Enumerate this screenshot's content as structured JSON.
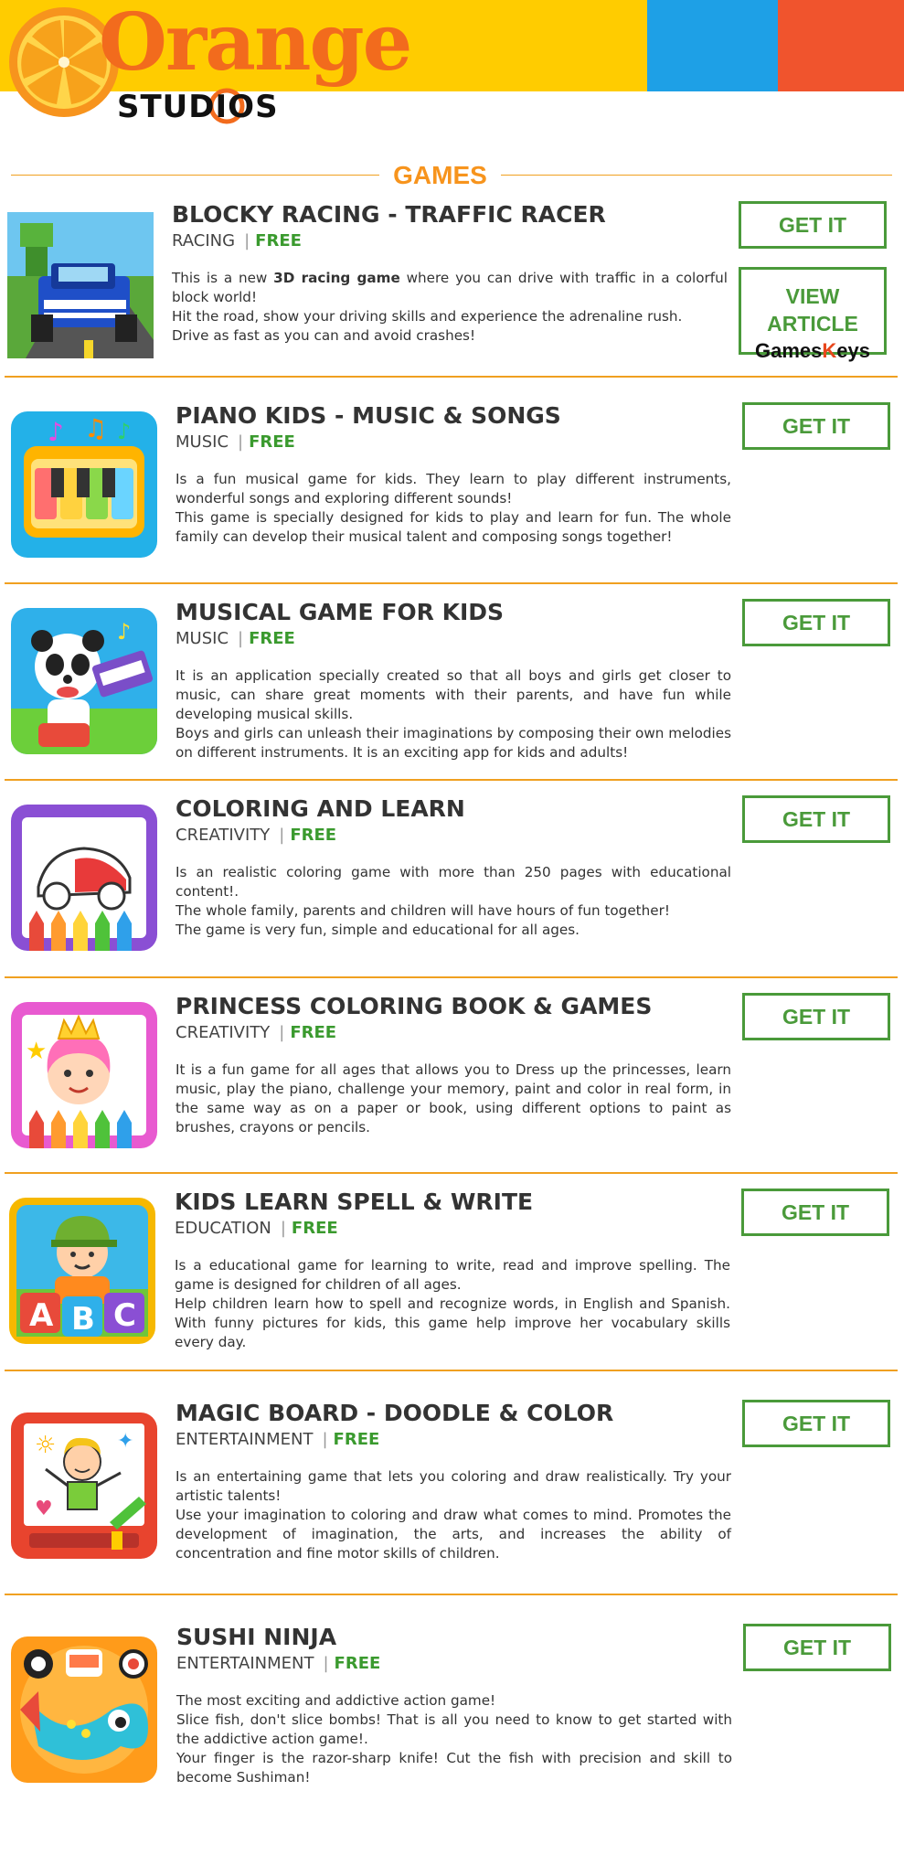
{
  "brand": {
    "logo_word": "Orange",
    "logo_sub": "STUDIOS",
    "colors": {
      "yellow": "#ffcc00",
      "blue": "#1ea0e6",
      "red": "#f0542d",
      "orange": "#f7941d",
      "green": "#4a9a3a"
    }
  },
  "section_title": "GAMES",
  "article_button": {
    "line1": "VIEW ARTICLE",
    "games": "Games",
    "k": "K",
    "eys": "eys"
  },
  "games": [
    {
      "title": "BLOCKY RACING - TRAFFIC RACER",
      "category": "RACING",
      "price": "FREE",
      "desc_intro": "This is a new ",
      "desc_bold": "3D racing game",
      "desc_rest": " where you can drive with traffic in a colorful block world!",
      "desc": [
        "Hit the road, show your driving skills and experience the adrenaline rush.",
        "Drive as fast as you can and avoid crashes!"
      ],
      "button": "GET IT",
      "icon": "blocky-car-icon"
    },
    {
      "title": "PIANO KIDS - MUSIC & SONGS",
      "category": "MUSIC",
      "price": "FREE",
      "desc": [
        "Is a fun musical game for kids. They learn to play different instruments, wonderful songs and exploring different sounds!",
        "This game is specially designed for kids to play and learn for fun. The whole family can develop their musical talent and composing songs together!"
      ],
      "button": "GET IT",
      "icon": "piano-icon"
    },
    {
      "title": "MUSICAL GAME FOR KIDS",
      "category": "MUSIC",
      "price": "FREE",
      "desc": [
        "It is an application specially created so that all boys and girls get closer to music, can share great moments with their parents, and have fun while developing musical skills.",
        "Boys and girls can unleash their imaginations by composing their own melodies on different instruments. It is an exciting app for kids and adults!"
      ],
      "button": "GET IT",
      "icon": "panda-keyboard-icon"
    },
    {
      "title": "COLORING AND LEARN",
      "category": "CREATIVITY",
      "price": "FREE",
      "desc": [
        "Is an realistic coloring game with more than 250 pages with educational content!.",
        "The whole family, parents and children will have hours of fun together!",
        "The game is very fun, simple and educational for all ages."
      ],
      "button": "GET IT",
      "icon": "coloring-car-icon"
    },
    {
      "title": "PRINCESS COLORING BOOK & GAMES",
      "category": "CREATIVITY",
      "price": "FREE",
      "desc": [
        "It is a fun game for all ages that allows you to Dress up the princesses, learn music, play the piano, challenge your memory, paint and color in real form, in the same way as on a paper or book, using different options to paint as brushes, crayons or pencils."
      ],
      "button": "GET IT",
      "icon": "princess-icon"
    },
    {
      "title": "KIDS LEARN SPELL & WRITE",
      "category": "EDUCATION",
      "price": "FREE",
      "desc": [
        "Is a educational game for learning to write, read and improve spelling. The game is designed for children of all ages.",
        "Help children learn how to spell and recognize words, in English and Spanish. With funny pictures for kids, this game help improve her vocabulary skills every day."
      ],
      "button": "GET IT",
      "icon": "abc-blocks-icon"
    },
    {
      "title": "MAGIC BOARD - DOODLE & COLOR",
      "category": "ENTERTAINMENT",
      "price": "FREE",
      "desc": [
        "Is an entertaining game that lets you coloring and draw realistically. Try your artistic talents!",
        "Use your imagination to coloring and draw what comes to mind. Promotes the development of imagination, the arts, and increases the ability of concentration and fine motor skills of children."
      ],
      "button": "GET IT",
      "icon": "magic-board-icon"
    },
    {
      "title": "SUSHI NINJA",
      "category": "ENTERTAINMENT",
      "price": "FREE",
      "desc": [
        "The most exciting and addictive action game!",
        "Slice fish, don't slice bombs!  That is all you need to know to get started with the addictive action game!.",
        "Your finger is the razor-sharp knife! Cut the fish with precision and skill to become Sushiman!"
      ],
      "button": "GET IT",
      "icon": "sushi-fish-icon"
    }
  ]
}
